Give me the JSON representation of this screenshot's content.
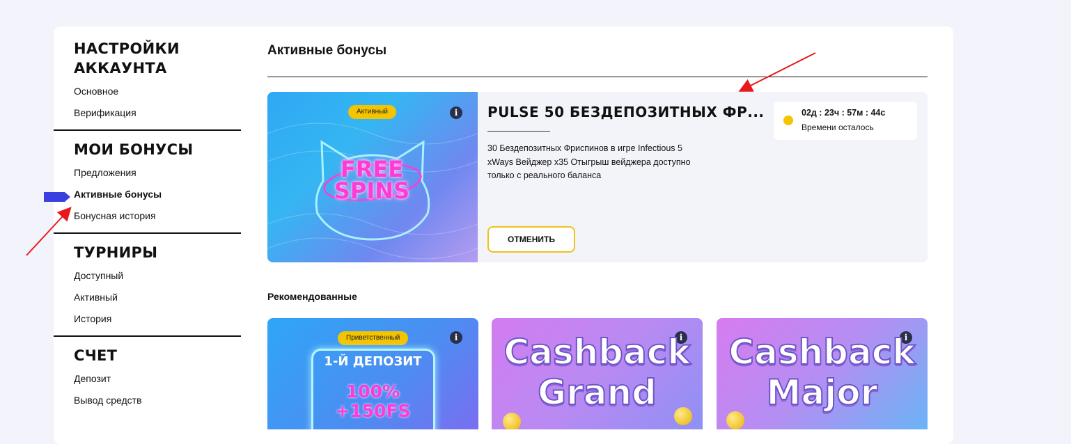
{
  "colors": {
    "background": "#f3f3fb",
    "accent_yellow": "#f5c400",
    "marker_blue": "#3a3fe0",
    "annotation_red": "#e8191c"
  },
  "sidebar": {
    "sections": [
      {
        "title": "НАСТРОЙКИ АККАУНТА",
        "items": [
          "Основное",
          "Верификация"
        ]
      },
      {
        "title": "МОИ БОНУСЫ",
        "items": [
          "Предложения",
          "Активные бонусы",
          "Бонусная история"
        ]
      },
      {
        "title": "ТУРНИРЫ",
        "items": [
          "Доступный",
          "Активный",
          "История"
        ]
      },
      {
        "title": "СЧЕТ",
        "items": [
          "Депозит",
          "Вывод средств"
        ]
      }
    ],
    "active_item": "Активные бонусы"
  },
  "main": {
    "title": "Активные бонусы",
    "active_bonus": {
      "badge": "Активный",
      "banner_text_line1": "FREE",
      "banner_text_line2": "SPINS",
      "name": "PULSE 50 БЕЗДЕПОЗИТНЫХ ФР...",
      "description": "30 Бездепозитных Фриспинов в игре Infectious 5 xWays Вейджер x35 Отыгрыш вейджера доступно только с реального баланса",
      "cancel_label": "ОТМЕНИТЬ",
      "timer_value": "02д : 23ч : 57м : 44с",
      "timer_label": "Времени осталось",
      "info_icon": "i"
    },
    "recommended_title": "Рекомендованные",
    "recommended": [
      {
        "badge": "Приветственный",
        "line1": "1-Й ДЕПОЗИТ",
        "line2": "100%",
        "line3": "+150FS"
      },
      {
        "line1": "Cashback",
        "line2": "Grand"
      },
      {
        "line1": "Cashback",
        "line2": "Major"
      }
    ]
  }
}
